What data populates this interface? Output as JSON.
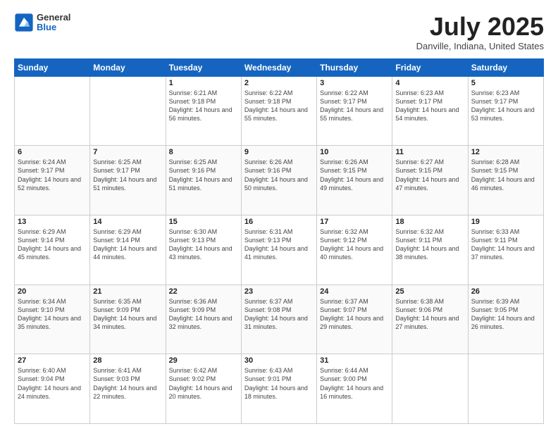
{
  "header": {
    "logo_general": "General",
    "logo_blue": "Blue",
    "month_title": "July 2025",
    "location": "Danville, Indiana, United States"
  },
  "days_of_week": [
    "Sunday",
    "Monday",
    "Tuesday",
    "Wednesday",
    "Thursday",
    "Friday",
    "Saturday"
  ],
  "weeks": [
    [
      {
        "day": "",
        "sunrise": "",
        "sunset": "",
        "daylight": ""
      },
      {
        "day": "",
        "sunrise": "",
        "sunset": "",
        "daylight": ""
      },
      {
        "day": "1",
        "sunrise": "Sunrise: 6:21 AM",
        "sunset": "Sunset: 9:18 PM",
        "daylight": "Daylight: 14 hours and 56 minutes."
      },
      {
        "day": "2",
        "sunrise": "Sunrise: 6:22 AM",
        "sunset": "Sunset: 9:18 PM",
        "daylight": "Daylight: 14 hours and 55 minutes."
      },
      {
        "day": "3",
        "sunrise": "Sunrise: 6:22 AM",
        "sunset": "Sunset: 9:17 PM",
        "daylight": "Daylight: 14 hours and 55 minutes."
      },
      {
        "day": "4",
        "sunrise": "Sunrise: 6:23 AM",
        "sunset": "Sunset: 9:17 PM",
        "daylight": "Daylight: 14 hours and 54 minutes."
      },
      {
        "day": "5",
        "sunrise": "Sunrise: 6:23 AM",
        "sunset": "Sunset: 9:17 PM",
        "daylight": "Daylight: 14 hours and 53 minutes."
      }
    ],
    [
      {
        "day": "6",
        "sunrise": "Sunrise: 6:24 AM",
        "sunset": "Sunset: 9:17 PM",
        "daylight": "Daylight: 14 hours and 52 minutes."
      },
      {
        "day": "7",
        "sunrise": "Sunrise: 6:25 AM",
        "sunset": "Sunset: 9:17 PM",
        "daylight": "Daylight: 14 hours and 51 minutes."
      },
      {
        "day": "8",
        "sunrise": "Sunrise: 6:25 AM",
        "sunset": "Sunset: 9:16 PM",
        "daylight": "Daylight: 14 hours and 51 minutes."
      },
      {
        "day": "9",
        "sunrise": "Sunrise: 6:26 AM",
        "sunset": "Sunset: 9:16 PM",
        "daylight": "Daylight: 14 hours and 50 minutes."
      },
      {
        "day": "10",
        "sunrise": "Sunrise: 6:26 AM",
        "sunset": "Sunset: 9:15 PM",
        "daylight": "Daylight: 14 hours and 49 minutes."
      },
      {
        "day": "11",
        "sunrise": "Sunrise: 6:27 AM",
        "sunset": "Sunset: 9:15 PM",
        "daylight": "Daylight: 14 hours and 47 minutes."
      },
      {
        "day": "12",
        "sunrise": "Sunrise: 6:28 AM",
        "sunset": "Sunset: 9:15 PM",
        "daylight": "Daylight: 14 hours and 46 minutes."
      }
    ],
    [
      {
        "day": "13",
        "sunrise": "Sunrise: 6:29 AM",
        "sunset": "Sunset: 9:14 PM",
        "daylight": "Daylight: 14 hours and 45 minutes."
      },
      {
        "day": "14",
        "sunrise": "Sunrise: 6:29 AM",
        "sunset": "Sunset: 9:14 PM",
        "daylight": "Daylight: 14 hours and 44 minutes."
      },
      {
        "day": "15",
        "sunrise": "Sunrise: 6:30 AM",
        "sunset": "Sunset: 9:13 PM",
        "daylight": "Daylight: 14 hours and 43 minutes."
      },
      {
        "day": "16",
        "sunrise": "Sunrise: 6:31 AM",
        "sunset": "Sunset: 9:13 PM",
        "daylight": "Daylight: 14 hours and 41 minutes."
      },
      {
        "day": "17",
        "sunrise": "Sunrise: 6:32 AM",
        "sunset": "Sunset: 9:12 PM",
        "daylight": "Daylight: 14 hours and 40 minutes."
      },
      {
        "day": "18",
        "sunrise": "Sunrise: 6:32 AM",
        "sunset": "Sunset: 9:11 PM",
        "daylight": "Daylight: 14 hours and 38 minutes."
      },
      {
        "day": "19",
        "sunrise": "Sunrise: 6:33 AM",
        "sunset": "Sunset: 9:11 PM",
        "daylight": "Daylight: 14 hours and 37 minutes."
      }
    ],
    [
      {
        "day": "20",
        "sunrise": "Sunrise: 6:34 AM",
        "sunset": "Sunset: 9:10 PM",
        "daylight": "Daylight: 14 hours and 35 minutes."
      },
      {
        "day": "21",
        "sunrise": "Sunrise: 6:35 AM",
        "sunset": "Sunset: 9:09 PM",
        "daylight": "Daylight: 14 hours and 34 minutes."
      },
      {
        "day": "22",
        "sunrise": "Sunrise: 6:36 AM",
        "sunset": "Sunset: 9:09 PM",
        "daylight": "Daylight: 14 hours and 32 minutes."
      },
      {
        "day": "23",
        "sunrise": "Sunrise: 6:37 AM",
        "sunset": "Sunset: 9:08 PM",
        "daylight": "Daylight: 14 hours and 31 minutes."
      },
      {
        "day": "24",
        "sunrise": "Sunrise: 6:37 AM",
        "sunset": "Sunset: 9:07 PM",
        "daylight": "Daylight: 14 hours and 29 minutes."
      },
      {
        "day": "25",
        "sunrise": "Sunrise: 6:38 AM",
        "sunset": "Sunset: 9:06 PM",
        "daylight": "Daylight: 14 hours and 27 minutes."
      },
      {
        "day": "26",
        "sunrise": "Sunrise: 6:39 AM",
        "sunset": "Sunset: 9:05 PM",
        "daylight": "Daylight: 14 hours and 26 minutes."
      }
    ],
    [
      {
        "day": "27",
        "sunrise": "Sunrise: 6:40 AM",
        "sunset": "Sunset: 9:04 PM",
        "daylight": "Daylight: 14 hours and 24 minutes."
      },
      {
        "day": "28",
        "sunrise": "Sunrise: 6:41 AM",
        "sunset": "Sunset: 9:03 PM",
        "daylight": "Daylight: 14 hours and 22 minutes."
      },
      {
        "day": "29",
        "sunrise": "Sunrise: 6:42 AM",
        "sunset": "Sunset: 9:02 PM",
        "daylight": "Daylight: 14 hours and 20 minutes."
      },
      {
        "day": "30",
        "sunrise": "Sunrise: 6:43 AM",
        "sunset": "Sunset: 9:01 PM",
        "daylight": "Daylight: 14 hours and 18 minutes."
      },
      {
        "day": "31",
        "sunrise": "Sunrise: 6:44 AM",
        "sunset": "Sunset: 9:00 PM",
        "daylight": "Daylight: 14 hours and 16 minutes."
      },
      {
        "day": "",
        "sunrise": "",
        "sunset": "",
        "daylight": ""
      },
      {
        "day": "",
        "sunrise": "",
        "sunset": "",
        "daylight": ""
      }
    ]
  ]
}
